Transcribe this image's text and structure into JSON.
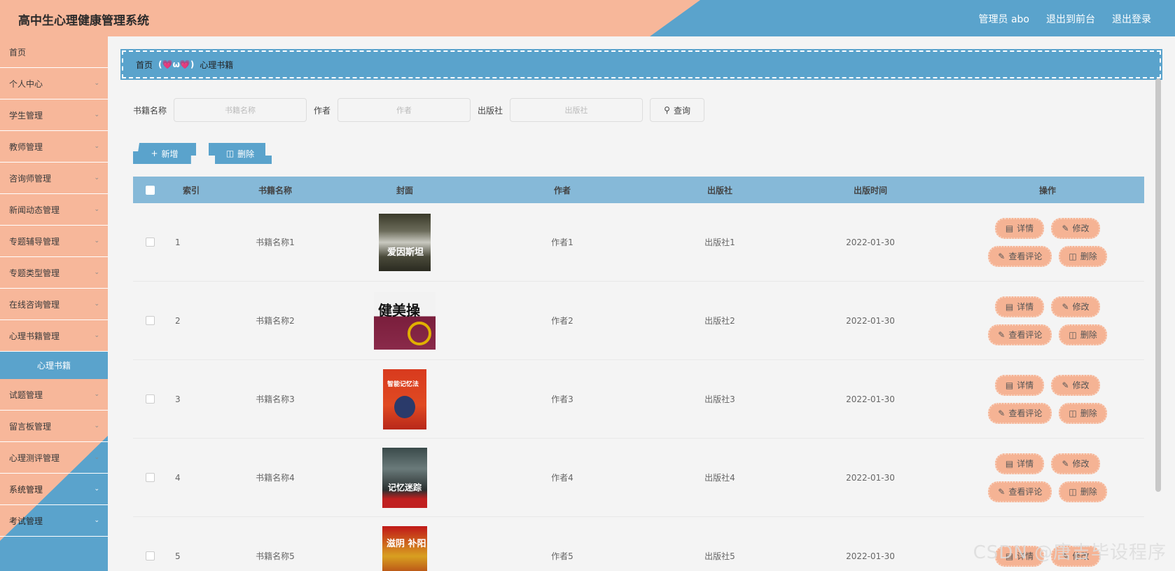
{
  "header": {
    "title": "高中生心理健康管理系统",
    "admin": "管理员 abo",
    "to_front": "退出到前台",
    "logout": "退出登录"
  },
  "sidebar": {
    "items": [
      {
        "label": "首页",
        "chevron": false
      },
      {
        "label": "个人中心",
        "chevron": true
      },
      {
        "label": "学生管理",
        "chevron": true
      },
      {
        "label": "教师管理",
        "chevron": true
      },
      {
        "label": "咨询师管理",
        "chevron": true
      },
      {
        "label": "新闻动态管理",
        "chevron": true
      },
      {
        "label": "专题辅导管理",
        "chevron": true
      },
      {
        "label": "专题类型管理",
        "chevron": true
      },
      {
        "label": "在线咨询管理",
        "chevron": true
      },
      {
        "label": "心理书籍管理",
        "chevron": true
      }
    ],
    "active_sub": "心理书籍",
    "items_after": [
      {
        "label": "试题管理",
        "chevron": true
      },
      {
        "label": "留言板管理",
        "chevron": true
      },
      {
        "label": "心理测评管理",
        "chevron": true
      },
      {
        "label": "系统管理",
        "chevron": true
      },
      {
        "label": "考试管理",
        "chevron": true
      }
    ]
  },
  "breadcrumb": {
    "home": "首页",
    "separator": "(💗ω💗)",
    "current": "心理书籍"
  },
  "search": {
    "name_label": "书籍名称",
    "name_placeholder": "书籍名称",
    "author_label": "作者",
    "author_placeholder": "作者",
    "press_label": "出版社",
    "press_placeholder": "出版社",
    "query_label": "查询"
  },
  "actions": {
    "add_label": "新增",
    "delete_label": "删除"
  },
  "table": {
    "headers": {
      "index": "索引",
      "name": "书籍名称",
      "cover": "封面",
      "author": "作者",
      "press": "出版社",
      "date": "出版时间",
      "ops": "操作"
    },
    "op_labels": {
      "detail": "详情",
      "edit": "修改",
      "comments": "查看评论",
      "delete": "删除"
    },
    "rows": [
      {
        "index": "1",
        "name": "书籍名称1",
        "author": "作者1",
        "press": "出版社1",
        "date": "2022-01-30",
        "cover_text": "爱因斯坦"
      },
      {
        "index": "2",
        "name": "书籍名称2",
        "author": "作者2",
        "press": "出版社2",
        "date": "2022-01-30",
        "cover_text": "健美操"
      },
      {
        "index": "3",
        "name": "书籍名称3",
        "author": "作者3",
        "press": "出版社3",
        "date": "2022-01-30",
        "cover_text": "智能记忆法"
      },
      {
        "index": "4",
        "name": "书籍名称4",
        "author": "作者4",
        "press": "出版社4",
        "date": "2022-01-30",
        "cover_text": "记忆迷踪"
      },
      {
        "index": "5",
        "name": "书籍名称5",
        "author": "作者5",
        "press": "出版社5",
        "date": "2022-01-30",
        "cover_text": "滋阴 补阳"
      }
    ]
  },
  "watermark": "CSDN @唐吉毕设程序"
}
